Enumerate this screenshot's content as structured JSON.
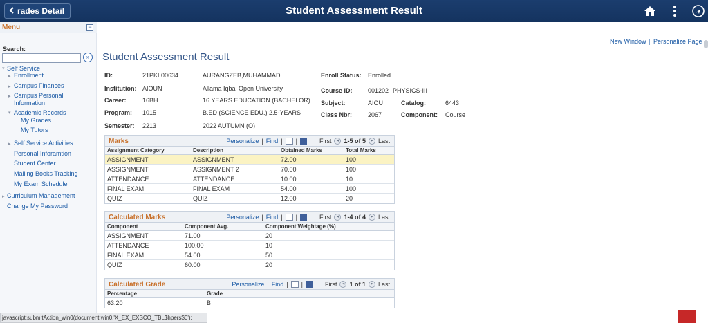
{
  "header": {
    "back_label": "rades Detail",
    "title": "Student Assessment Result",
    "icons": [
      "home-icon",
      "more-vertical-icon",
      "navigation-icon"
    ],
    "bar_color": "#1b3d6e"
  },
  "sidebar": {
    "menu_title": "Menu",
    "search_label": "Search:",
    "search_value": "",
    "items": [
      {
        "label": "Self Service"
      },
      {
        "label": "Enrollment"
      },
      {
        "label": "Campus Finances"
      },
      {
        "label": "Campus Personal"
      },
      {
        "label": "Information"
      },
      {
        "label": "Academic Records"
      },
      {
        "label": "My Grades"
      },
      {
        "label": "My Tutors"
      },
      {
        "label": "Self Service Activities"
      },
      {
        "label": "Personal Inforamtion"
      },
      {
        "label": "Student Center"
      },
      {
        "label": "Mailing Books Tracking"
      },
      {
        "label": "My Exam Schedule"
      },
      {
        "label": "Curriculum Management"
      },
      {
        "label": "Change My Password"
      }
    ]
  },
  "links": {
    "new_window": "New Window",
    "separator": "|",
    "personalize_page": "Personalize Page"
  },
  "page_title": "Student Assessment Result",
  "student": {
    "id_label": "ID:",
    "id": "21PKL00634",
    "name": "AURANGZEB,MUHAMMAD .",
    "institution_label": "Institution:",
    "institution_code": "AIOUN",
    "institution_name": "Allama Iqbal Open University",
    "career_label": "Career:",
    "career_code": "16BH",
    "career_name": "16 YEARS EDUCATION (BACHELOR)",
    "program_label": "Program:",
    "program_code": "1015",
    "program_name": "B.ED (SCIENCE EDU.) 2.5-YEARS",
    "semester_label": "Semester:",
    "semester_code": "2213",
    "semester_name": "2022 AUTUMN (O)",
    "enroll_status_label": "Enroll Status:",
    "enroll_status": "Enrolled",
    "course_id_label": "Course ID:",
    "course_id": "001202",
    "course_name": "PHYSICS-III",
    "subject_label": "Subject:",
    "subject": "AIOU",
    "catalog_label": "Catalog:",
    "catalog": "6443",
    "class_nbr_label": "Class Nbr:",
    "class_nbr": "2067",
    "component_label": "Component:",
    "component": "Course"
  },
  "grid_tools": {
    "personalize": "Personalize",
    "find": "Find",
    "first": "First",
    "last": "Last",
    "bar": "|"
  },
  "marks": {
    "title": "Marks",
    "range": "1-5 of 5",
    "columns": [
      "Assignment Category",
      "Description",
      "Obtained Marks",
      "Total Marks"
    ],
    "rows": [
      [
        "ASSIGNMENT",
        "ASSIGNMENT",
        "72.00",
        "100"
      ],
      [
        "ASSIGNMENT",
        "ASSIGNMENT 2",
        "70.00",
        "100"
      ],
      [
        "ATTENDANCE",
        "ATTENDANCE",
        "10.00",
        "10"
      ],
      [
        "FINAL EXAM",
        "FINAL EXAM",
        "54.00",
        "100"
      ],
      [
        "QUIZ",
        "QUIZ",
        "12.00",
        "20"
      ]
    ]
  },
  "calculated_marks": {
    "title": "Calculated Marks",
    "range": "1-4 of 4",
    "columns": [
      "Component",
      "Component Avg.",
      "Component Weightage (%)"
    ],
    "rows": [
      [
        "ASSIGNMENT",
        "71.00",
        "20"
      ],
      [
        "ATTENDANCE",
        "100.00",
        "10"
      ],
      [
        "FINAL EXAM",
        "54.00",
        "50"
      ],
      [
        "QUIZ",
        "60.00",
        "20"
      ]
    ]
  },
  "calculated_grade": {
    "title": "Calculated Grade",
    "range": "1 of 1",
    "columns": [
      "Percentage",
      "Grade"
    ],
    "rows": [
      [
        "63.20",
        "B"
      ]
    ]
  },
  "status_bar": "javascript:submitAction_win0(document.win0,'X_EX_EXSCO_TBL$hpers$0');",
  "colors": {
    "accent_orange": "#c8702a",
    "link_blue": "#1b5aa5",
    "highlight_row": "#fbf3c3"
  }
}
